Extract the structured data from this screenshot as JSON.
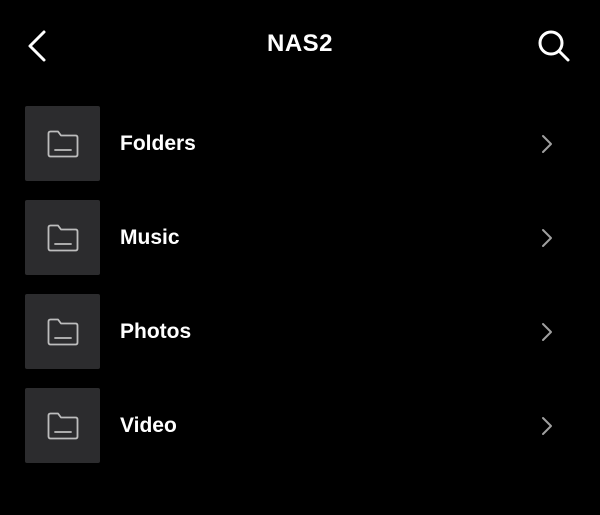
{
  "header": {
    "title": "NAS2",
    "back_icon": "chevron-left-icon",
    "search_icon": "search-icon"
  },
  "list": {
    "items": [
      {
        "label": "Folders",
        "icon": "folder-icon"
      },
      {
        "label": "Music",
        "icon": "folder-icon"
      },
      {
        "label": "Photos",
        "icon": "folder-icon"
      },
      {
        "label": "Video",
        "icon": "folder-icon"
      }
    ]
  },
  "colors": {
    "background": "#000000",
    "thumb_background": "#2c2c2e",
    "text": "#ffffff",
    "icon_muted": "#bdbdbd",
    "chevron": "#a0a0a0"
  }
}
